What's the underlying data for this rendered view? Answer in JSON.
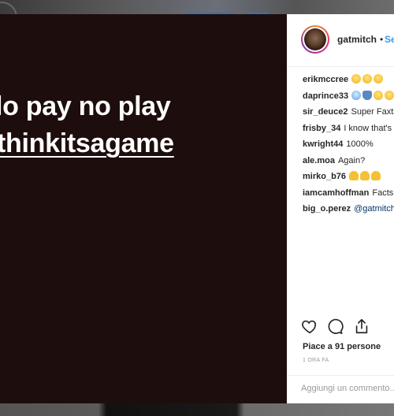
{
  "post": {
    "story_lines": [
      "lo pay no play",
      "thinkitsagame"
    ]
  },
  "header": {
    "username": "gatmitch",
    "separator": "•",
    "follow_label": "Segui"
  },
  "comments": [
    {
      "user": "erikmccree",
      "text": "",
      "emojis": [
        "laugh",
        "laugh",
        "laugh"
      ]
    },
    {
      "user": "daprince33",
      "text": "",
      "emojis": [
        "scream",
        "person",
        "laugh",
        "laugh"
      ]
    },
    {
      "user": "sir_deuce2",
      "text": "Super Faxts",
      "emojis": []
    },
    {
      "user": "frisby_34",
      "text": "I know that's",
      "emojis": []
    },
    {
      "user": "kwright44",
      "text": "1000%",
      "emojis": []
    },
    {
      "user": "ale.moa",
      "text": "Again?",
      "emojis": []
    },
    {
      "user": "mirko_b76",
      "text": "",
      "emojis": [
        "muscle",
        "muscle",
        "muscle"
      ]
    },
    {
      "user": "iamcamhoffman",
      "text": "Facts",
      "emojis": []
    },
    {
      "user": "big_o.perez",
      "text": "@gatmitch",
      "emojis": []
    }
  ],
  "actions": {
    "like_icon": "heart-icon",
    "comment_icon": "comment-icon",
    "share_icon": "share-icon"
  },
  "likes_text": "Piace a 91 persone",
  "timestamp": "1 ORA FA",
  "comment_input": {
    "placeholder": "Aggiungi un commento..."
  },
  "colors": {
    "accent": "#3897f0",
    "post_background": "#1d0e0d"
  }
}
